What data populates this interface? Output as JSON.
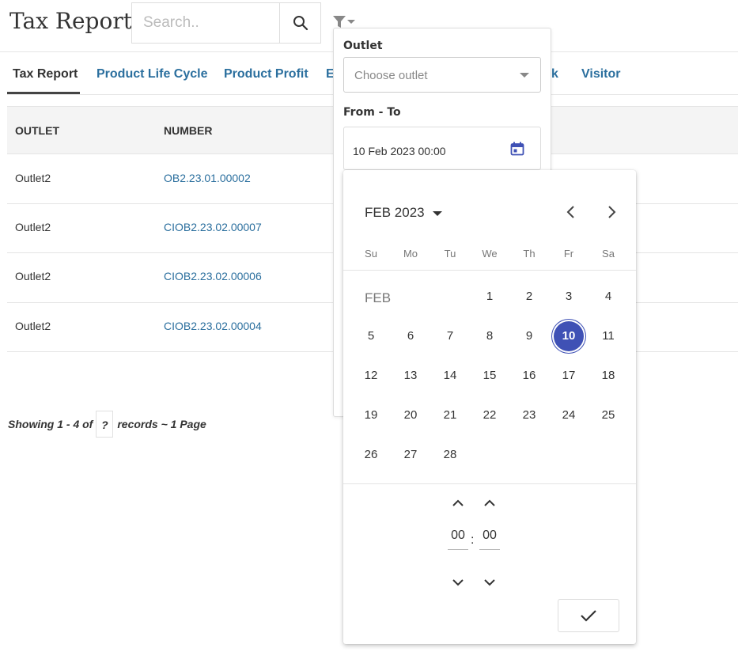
{
  "header": {
    "title": "Tax Report",
    "search_placeholder": "Search.."
  },
  "tabs": [
    {
      "label": "Tax Report",
      "active": true
    },
    {
      "label": "Product Life Cycle"
    },
    {
      "label": "Product Profit"
    },
    {
      "label": "E"
    },
    {
      "label": "k"
    },
    {
      "label": "Visitor"
    }
  ],
  "table": {
    "columns": [
      "OUTLET",
      "NUMBER"
    ],
    "rows": [
      {
        "outlet": "Outlet2",
        "number": "OB2.23.01.00002"
      },
      {
        "outlet": "Outlet2",
        "number": "CIOB2.23.02.00007"
      },
      {
        "outlet": "Outlet2",
        "number": "CIOB2.23.02.00006"
      },
      {
        "outlet": "Outlet2",
        "number": "CIOB2.23.02.00004"
      }
    ]
  },
  "pagination": {
    "prefix": "Showing 1 - 4 of",
    "count": "?",
    "suffix": "records ~ 1 Page"
  },
  "filter": {
    "outlet_label": "Outlet",
    "outlet_placeholder": "Choose outlet",
    "range_label": "From - To",
    "date_value": "10 Feb 2023 00:00"
  },
  "calendar": {
    "month_year": "FEB 2023",
    "month_short": "FEB",
    "weekdays": [
      "Su",
      "Mo",
      "Tu",
      "We",
      "Th",
      "Fr",
      "Sa"
    ],
    "first_weekday_index": 3,
    "days_in_month": 28,
    "selected_day": 10,
    "hour": "00",
    "minute": "00",
    "time_separator": ":"
  },
  "colors": {
    "link": "#2b6f9e",
    "accent": "#3f51b5"
  }
}
